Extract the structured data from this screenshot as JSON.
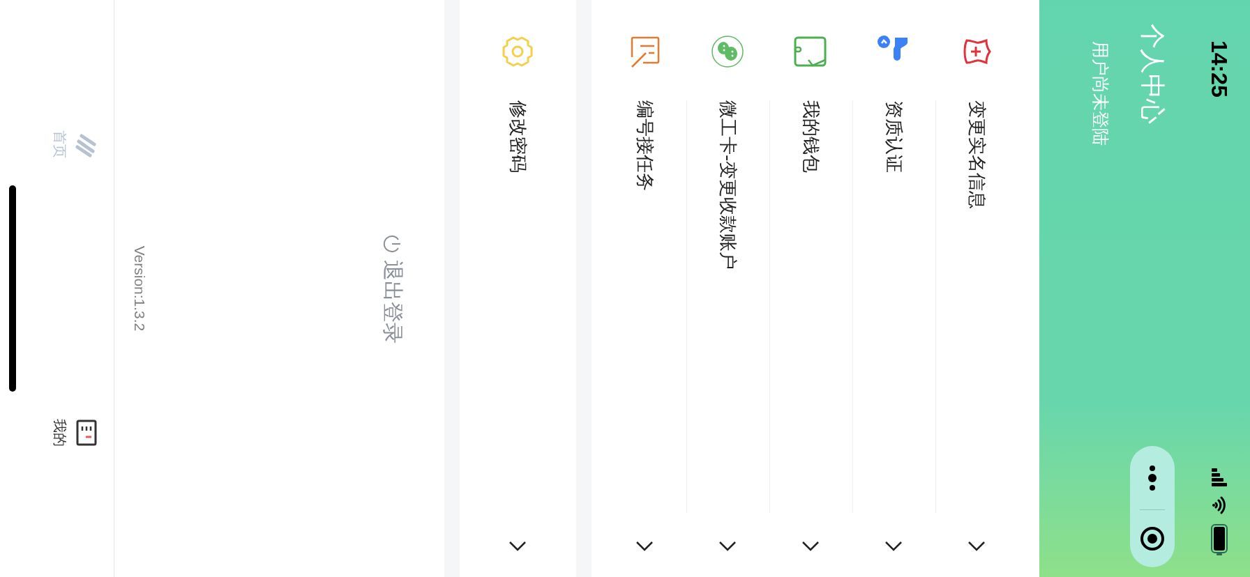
{
  "status_bar": {
    "time": "14:25"
  },
  "header": {
    "title": "个人中心",
    "subtitle": "用户尚未登陆"
  },
  "menu_groups": [
    {
      "items": [
        {
          "kind": "shield",
          "label": "变更实名信息"
        },
        {
          "kind": "badge",
          "label": "资质认证"
        },
        {
          "kind": "wallet",
          "label": "我的钱包"
        },
        {
          "kind": "wechat",
          "label": "微工卡-变更收款账户"
        },
        {
          "kind": "note",
          "label": "编号接任务"
        }
      ]
    },
    {
      "items": [
        {
          "kind": "gear",
          "label": "修改密码"
        }
      ]
    }
  ],
  "logout": {
    "label": "退出登录"
  },
  "version": "Version:1.3.2",
  "tabs": [
    {
      "kind": "home",
      "label": "首页",
      "selected": false
    },
    {
      "kind": "mine",
      "label": "我的",
      "selected": true
    }
  ]
}
